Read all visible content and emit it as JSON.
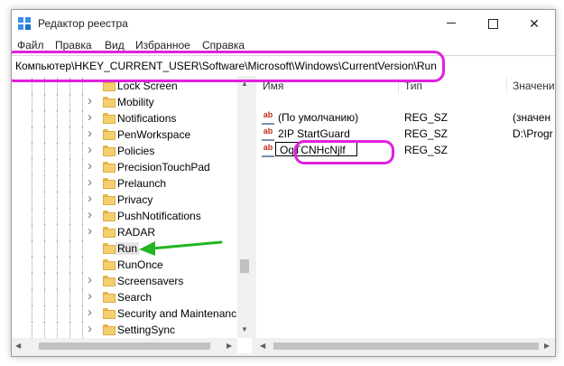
{
  "window": {
    "title": "Редактор реестра",
    "controls": {
      "minimize": "minimize",
      "maximize": "maximize",
      "close": "✕"
    }
  },
  "menu": [
    "Файл",
    "Правка",
    "Вид",
    "Избранное",
    "Справка"
  ],
  "address": "Компьютер\\HKEY_CURRENT_USER\\Software\\Microsoft\\Windows\\CurrentVersion\\Run",
  "tree": {
    "items": [
      {
        "label": "Lock Screen",
        "expandable": false
      },
      {
        "label": "Mobility",
        "expandable": true
      },
      {
        "label": "Notifications",
        "expandable": true
      },
      {
        "label": "PenWorkspace",
        "expandable": true
      },
      {
        "label": "Policies",
        "expandable": true
      },
      {
        "label": "PrecisionTouchPad",
        "expandable": true
      },
      {
        "label": "Prelaunch",
        "expandable": true
      },
      {
        "label": "Privacy",
        "expandable": true
      },
      {
        "label": "PushNotifications",
        "expandable": true
      },
      {
        "label": "RADAR",
        "expandable": true
      },
      {
        "label": "Run",
        "expandable": false,
        "selected": true
      },
      {
        "label": "RunOnce",
        "expandable": false
      },
      {
        "label": "Screensavers",
        "expandable": true
      },
      {
        "label": "Search",
        "expandable": true
      },
      {
        "label": "Security and Maintenanc",
        "expandable": true
      },
      {
        "label": "SettingSync",
        "expandable": true
      }
    ]
  },
  "list": {
    "columns": [
      "Имя",
      "Тип",
      "Значени"
    ],
    "rows": [
      {
        "name": "(По умолчанию)",
        "type": "REG_SZ",
        "value": "(значен"
      },
      {
        "name": "2IP StartGuard",
        "type": "REG_SZ",
        "value": "D:\\Progr"
      },
      {
        "name": "OqTCNHcNjlf",
        "type": "REG_SZ",
        "value": "",
        "editing": true
      }
    ]
  },
  "colors": {
    "annotation_highlight": "#e020e0",
    "annotation_arrow": "#22b622"
  }
}
